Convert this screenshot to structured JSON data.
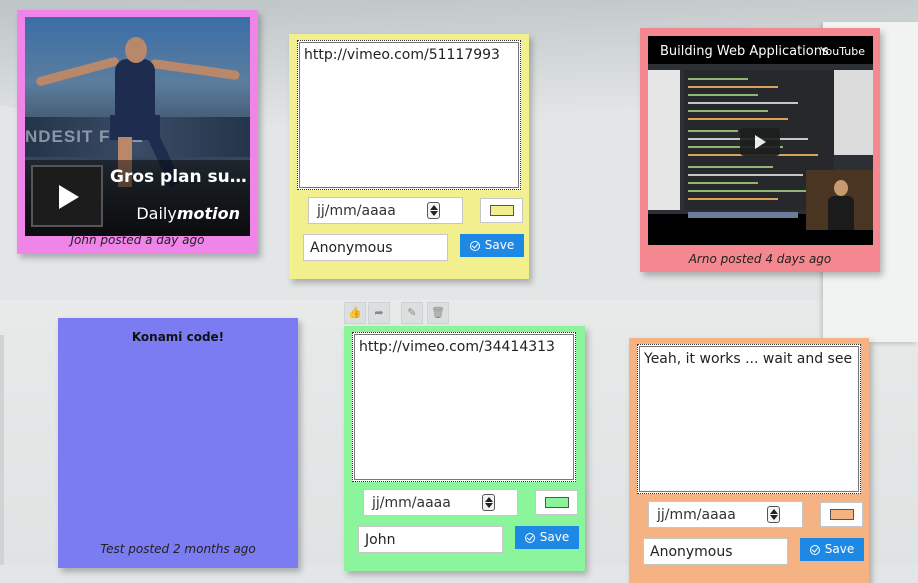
{
  "notes": {
    "video_dailymotion": {
      "video_title": "Gros plan su…",
      "provider_prefix": "Daily",
      "provider_suffix": "motion",
      "caption": "John posted a day ago",
      "color": "#ef85e8",
      "banner_text": "NDESIT F-GE"
    },
    "edit_yellow": {
      "url": "http://vimeo.com/51117993",
      "date_placeholder": "jj/mm/aaaa",
      "author": "Anonymous",
      "save_label": "Save",
      "color": "#f2ef8f"
    },
    "video_youtube": {
      "video_title": "Building Web Applications",
      "provider": "YouTube",
      "caption": "Arno posted 4 days ago",
      "color": "#f4878f"
    },
    "konami": {
      "title": "Konami code!",
      "caption": "Test posted 2 months ago",
      "color": "#7b7bf2"
    },
    "edit_green": {
      "url": "http://vimeo.com/34414313",
      "date_placeholder": "jj/mm/aaaa",
      "author": "John",
      "save_label": "Save",
      "color": "#8af59a"
    },
    "edit_orange": {
      "text": "Yeah, it works ... wait and see",
      "date_placeholder": "jj/mm/aaaa",
      "author": "Anonymous",
      "save_label": "Save",
      "color": "#f5b383"
    }
  },
  "toolbar": {
    "icons": [
      "thumbs-up-icon",
      "share-icon",
      "edit-icon",
      "trash-icon"
    ]
  }
}
